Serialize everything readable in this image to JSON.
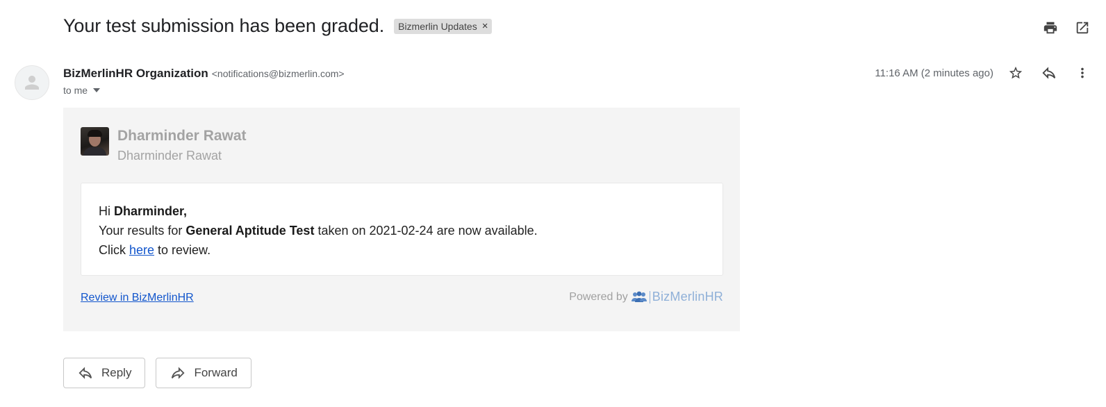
{
  "header": {
    "subject": "Your test submission has been graded.",
    "label_chip": "Bizmerlin Updates",
    "label_remove": "×",
    "icons": {
      "print": "print-icon",
      "open_new_window": "open-in-new-icon"
    }
  },
  "sender": {
    "name": "BizMerlinHR Organization",
    "email": "<notifications@bizmerlin.com>",
    "recipient": "to me",
    "timestamp": "11:16 AM (2 minutes ago)",
    "icons": {
      "star": "star-icon",
      "reply": "reply-icon",
      "more": "more-vert-icon"
    }
  },
  "body": {
    "profile_name": "Dharminder Rawat",
    "profile_subtitle": "Dharminder Rawat",
    "greeting_prefix": "Hi ",
    "greeting_name": "Dharminder,",
    "results_prefix": "Your results for ",
    "test_name": "General Aptitude Test",
    "results_suffix": " taken on 2021-02-24 are now available.",
    "click_prefix": "Click ",
    "link_text": "here",
    "click_suffix": " to review.",
    "review_link": "Review in BizMerlinHR",
    "powered_by": "Powered by",
    "brand": "BizMerlinHR",
    "colors": {
      "link": "#1155cc",
      "brand": "#8fb0d8",
      "panel": "#f4f4f4"
    }
  },
  "actions": {
    "reply_label": "Reply",
    "forward_label": "Forward"
  }
}
